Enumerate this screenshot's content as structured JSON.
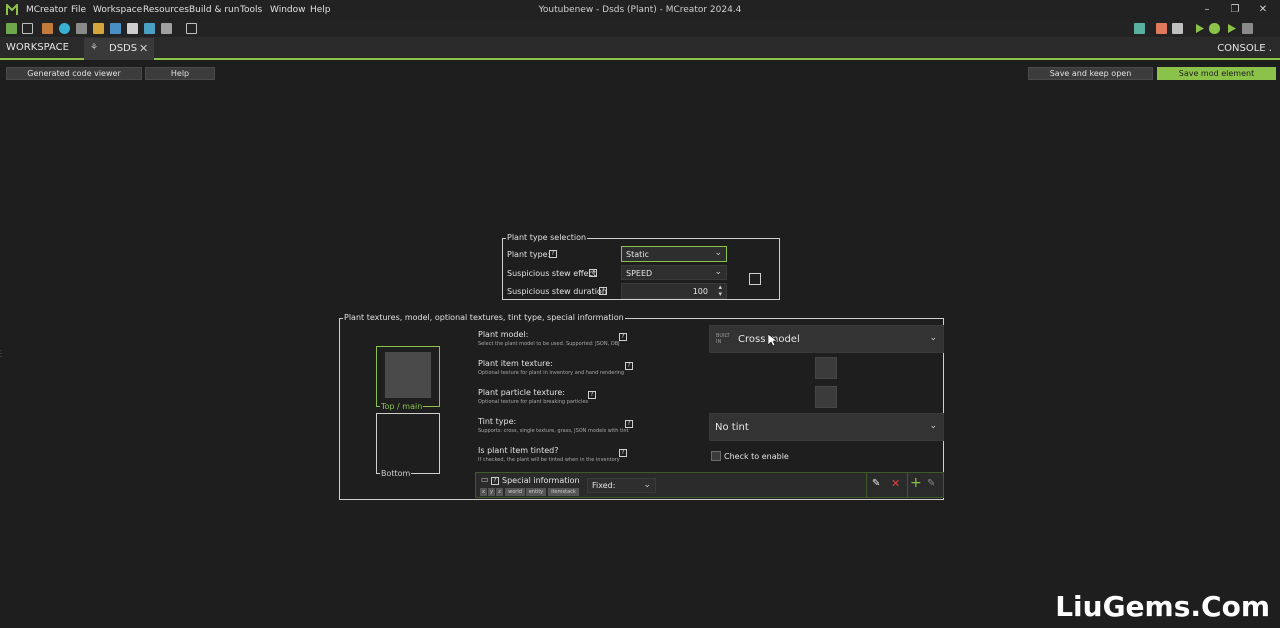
{
  "menu": {
    "app": "MCreator",
    "items": [
      "File",
      "Workspace",
      "Resources",
      "Build & run",
      "Tools",
      "Window",
      "Help"
    ]
  },
  "window": {
    "title": "Youtubenew - Dsds (Plant) - MCreator 2024.4"
  },
  "tabs": {
    "workspace": "WORKSPACE",
    "current": "DSDS",
    "console": "CONSOLE ."
  },
  "actions": {
    "generated_code_viewer": "Generated code viewer",
    "help": "Help",
    "save_keep_open": "Save and keep open",
    "save_mod_element": "Save mod element"
  },
  "plant_type_panel": {
    "title": "Plant type selection",
    "plant_type_label": "Plant type:",
    "plant_type_value": "Static",
    "stew_effect_label": "Suspicious stew effect",
    "stew_effect_value": "SPEED",
    "stew_duration_label": "Suspicious stew duration",
    "stew_duration_value": "100"
  },
  "texture_panel": {
    "title": "Plant textures, model, optional textures, tint type, special information",
    "top_label": "Top / main",
    "bottom_label": "Bottom",
    "model_label": "Plant model:",
    "model_desc": "Select the plant model to be used. Supported: JSON, OBJ",
    "model_badge": "BUILT IN",
    "model_value": "Cross model",
    "item_texture_label": "Plant item texture:",
    "item_texture_desc": "Optional texture for plant in inventory and hand rendering",
    "particle_texture_label": "Plant particle texture:",
    "particle_texture_desc": "Optional texture for plant breaking particles",
    "tint_label": "Tint type:",
    "tint_desc": "Supports: cross, single texture, grass, JSON models with tint",
    "tint_value": "No tint",
    "item_tinted_label": "Is plant item tinted?",
    "item_tinted_desc": "If checked, the plant will be tinted when in the inventory",
    "check_label": "Check to enable",
    "special_info_label": "Special information",
    "special_tags": [
      "x",
      "y",
      "z",
      "world",
      "entity",
      "itemstack"
    ],
    "fixed_label": "Fixed:"
  },
  "watermark": "LiuGems.Com",
  "colors": {
    "accent": "#8bc34a",
    "background": "#1e1e1e"
  }
}
